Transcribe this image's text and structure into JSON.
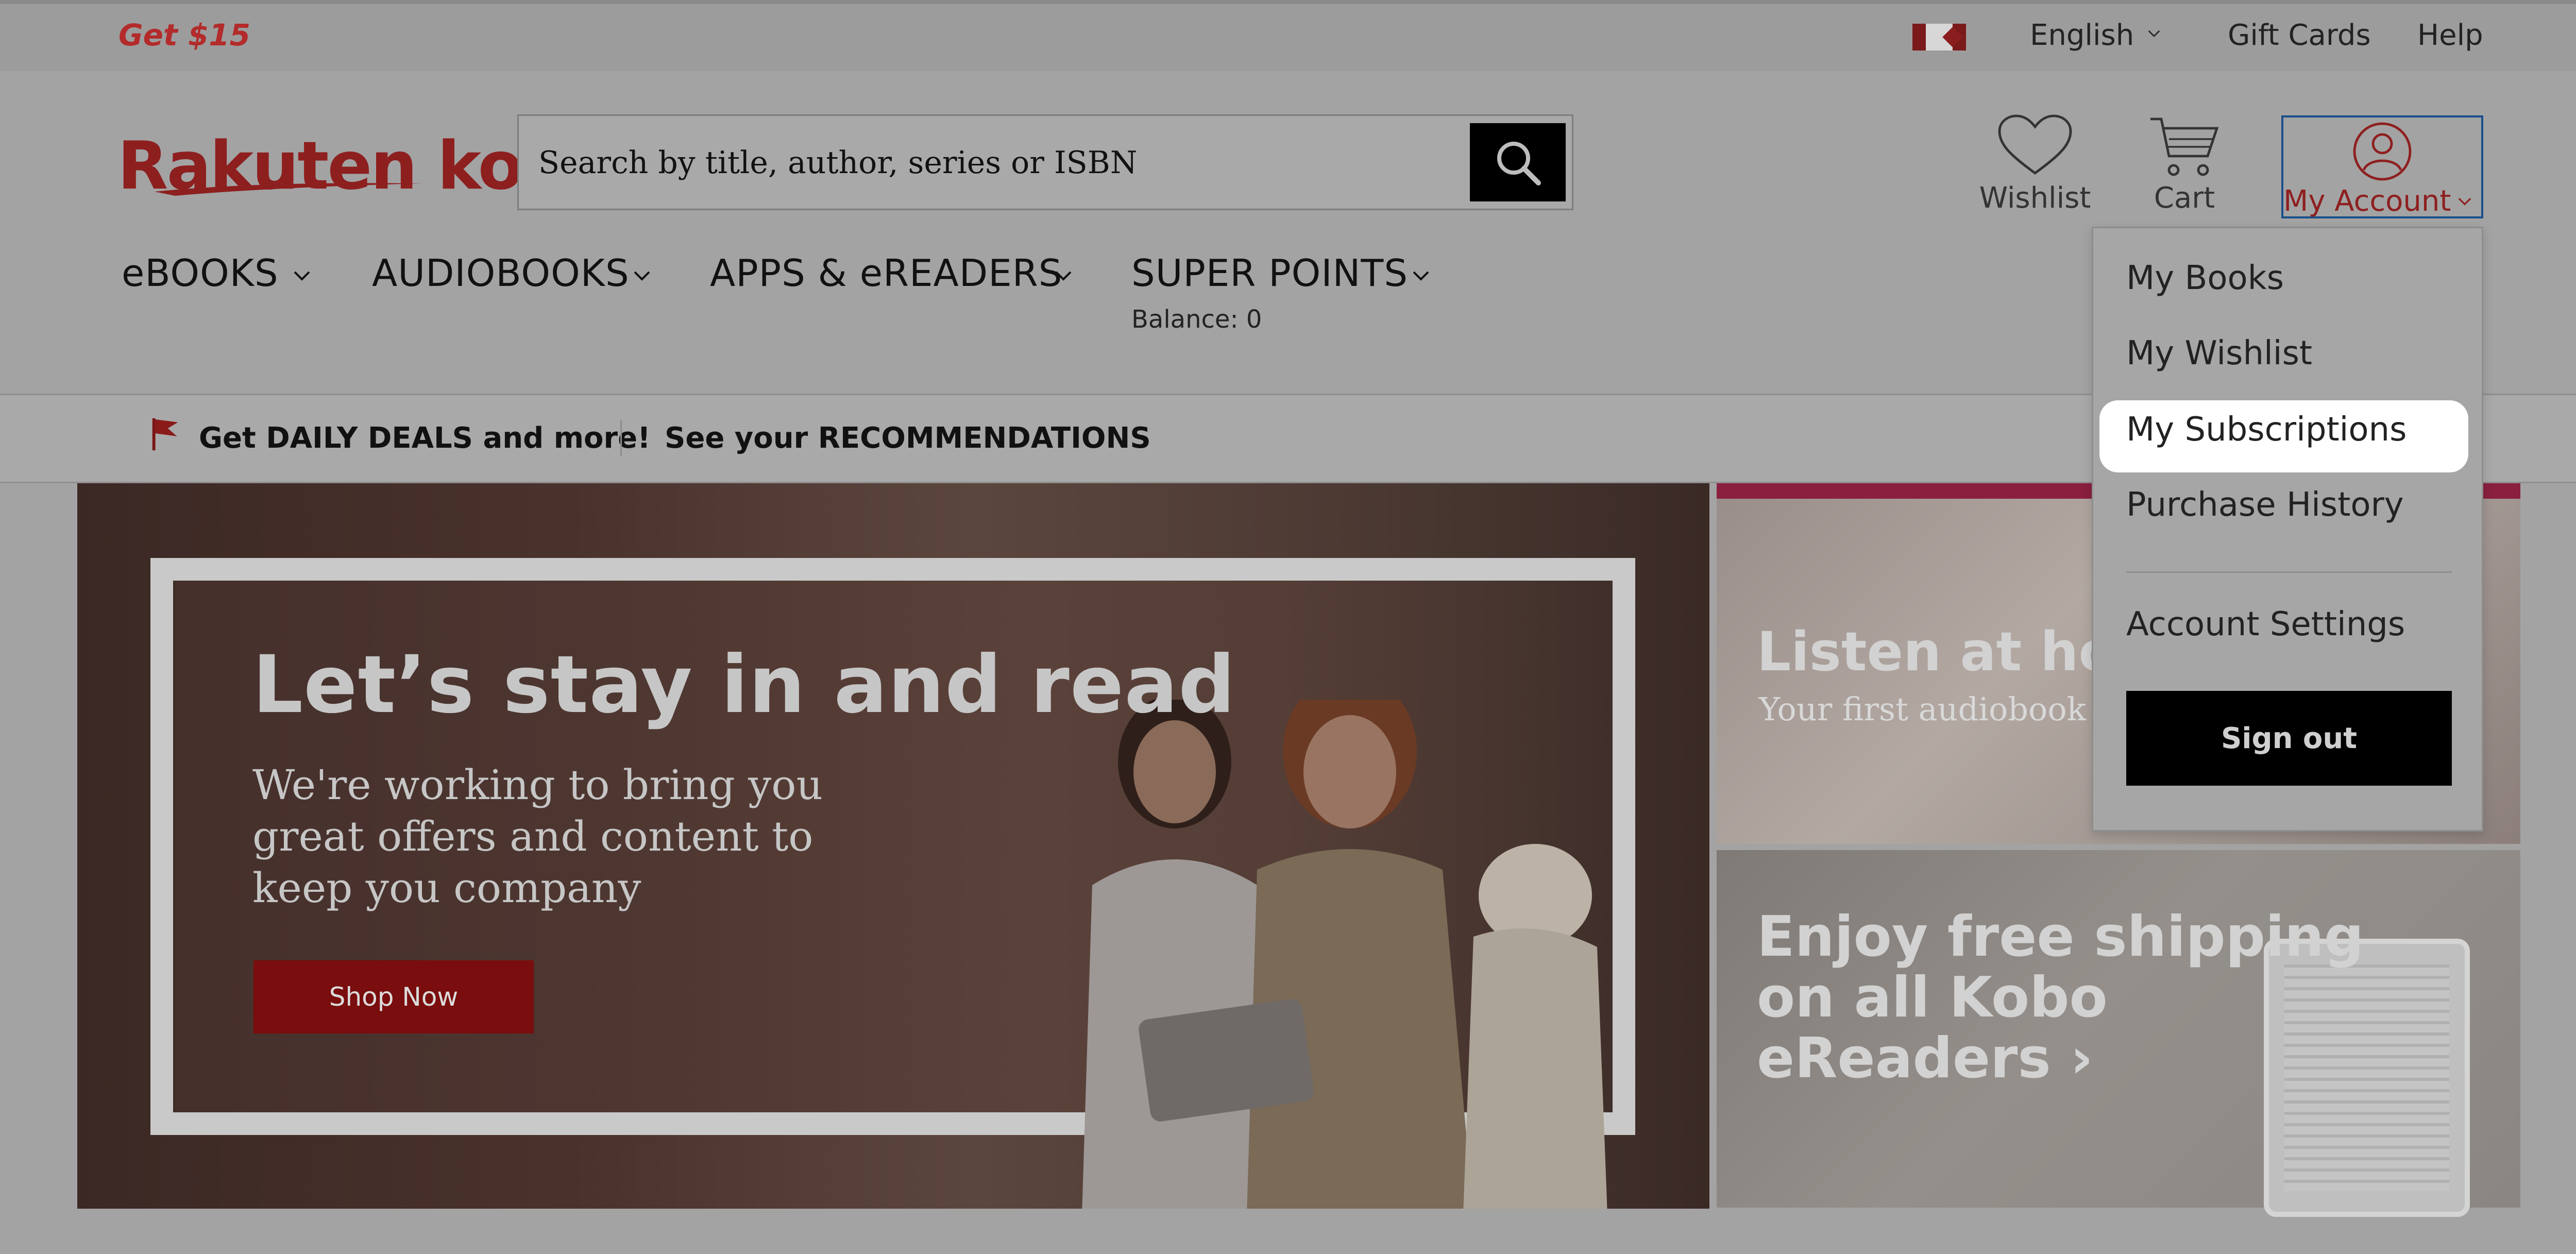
{
  "topbar": {
    "promo": "Get $15",
    "language": "English",
    "gift_cards": "Gift Cards",
    "help": "Help"
  },
  "header": {
    "logo": "Rakuten kobo",
    "search_placeholder": "Search by title, author, series or ISBN",
    "wishlist_label": "Wishlist",
    "cart_label": "Cart",
    "account_label": "My Account"
  },
  "nav": {
    "items": [
      {
        "label": "eBOOKS"
      },
      {
        "label": "AUDIOBOOKS"
      },
      {
        "label": "APPS & eREADERS"
      },
      {
        "label": "SUPER POINTS"
      }
    ],
    "balance": "Balance: 0"
  },
  "deals_bar": {
    "deals": "Get DAILY DEALS and more!",
    "recommendations": "See your RECOMMENDATIONS"
  },
  "hero": {
    "title": "Let’s stay in and read",
    "subtitle": "We're working to bring you great offers and content to keep you company",
    "button": "Shop Now"
  },
  "promos": {
    "audiobook_title": "Listen at hor",
    "audiobook_sub": "Your first audiobook",
    "shipping_title": "Enjoy free shipping on all Kobo eReaders ›"
  },
  "account_menu": {
    "items": [
      "My Books",
      "My Wishlist",
      "My Subscriptions",
      "Purchase History",
      "Account Settings"
    ],
    "highlighted": "My Subscriptions",
    "sign_out": "Sign out"
  },
  "colors": {
    "brand_red": "#8e1f1f",
    "focus_blue": "#1a4f8a",
    "button_red": "#7a0d0d",
    "overlay_gray": "#a3a3a3"
  }
}
